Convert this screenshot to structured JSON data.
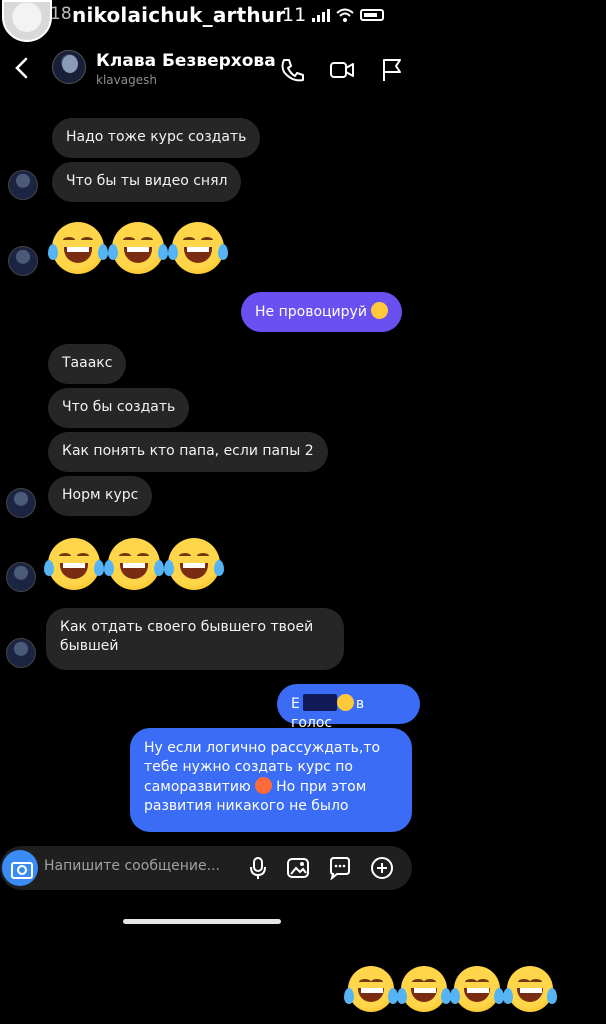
{
  "story": {
    "time_fragment": "18",
    "username": "nikolaichuk_arthur",
    "clock": "11"
  },
  "chat": {
    "contact_name": "Клава Безверхова",
    "contact_handle": "klavagesh",
    "header_icons": [
      "back-icon",
      "phone-icon",
      "video-icon",
      "flag-icon"
    ]
  },
  "messages": {
    "m1": "Надо тоже курс создать",
    "m2": "Что бы ты видео снял",
    "m3_emoji": "😂😂😂",
    "m4_out": "Не провоцируй",
    "m5": "Тааакс",
    "m6": "Что бы создать",
    "m7": "Как понять кто папа, если папы 2",
    "m8": "Норм курс",
    "m9_emoji": "😂😂😂",
    "m10": "Как отдать своего бывшего твоей бывшей",
    "m11_out_tail": "в голос",
    "m11_out_lead": "Е",
    "m12_out": "Ну если логично рассуждать,то тебе нужно создать курс по саморазвитию",
    "m12_out_tail": "Но при этом развития никакого не было"
  },
  "composer": {
    "placeholder": "Напишите сообщение..."
  },
  "overlay": {
    "emojis": "😂😂😂😂"
  },
  "colors": {
    "incoming_bubble": "#262626",
    "outgoing_purple": "#6a50f0",
    "outgoing_blue": "#3a6cf5",
    "camera_button": "#3b8bf6"
  }
}
